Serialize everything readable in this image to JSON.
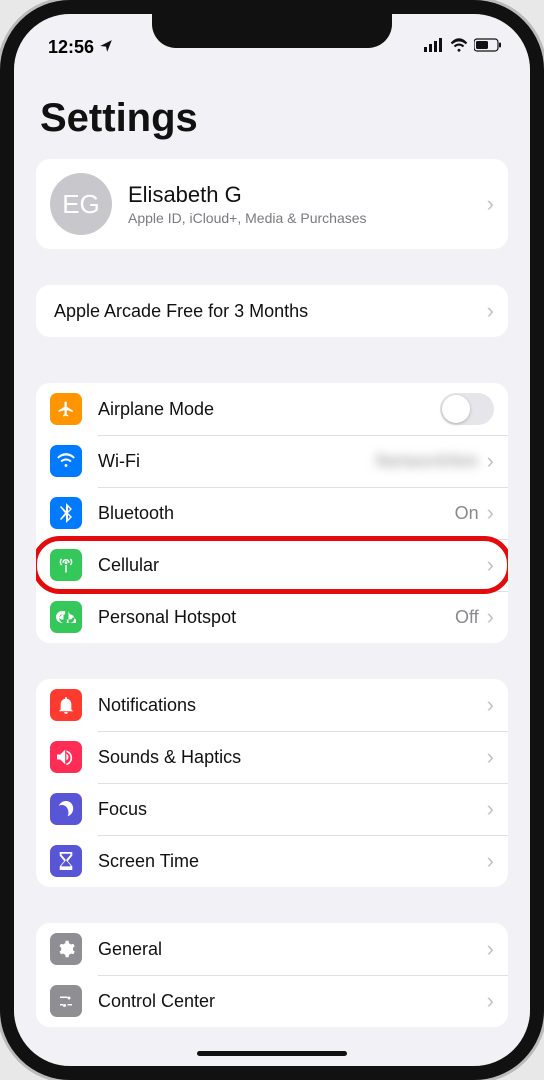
{
  "status": {
    "time": "12:56"
  },
  "title": "Settings",
  "profile": {
    "initials": "EG",
    "name": "Elisabeth G",
    "subtitle": "Apple ID, iCloud+, Media & Purchases"
  },
  "promo": {
    "label": "Apple Arcade Free for 3 Months"
  },
  "connectivity": {
    "airplane": {
      "label": "Airplane Mode"
    },
    "wifi": {
      "label": "Wi-Fi",
      "value": "NetworkNm"
    },
    "bluetooth": {
      "label": "Bluetooth",
      "value": "On"
    },
    "cellular": {
      "label": "Cellular"
    },
    "hotspot": {
      "label": "Personal Hotspot",
      "value": "Off"
    }
  },
  "alerts": {
    "notifications": {
      "label": "Notifications"
    },
    "sounds": {
      "label": "Sounds & Haptics"
    },
    "focus": {
      "label": "Focus"
    },
    "screentime": {
      "label": "Screen Time"
    }
  },
  "system": {
    "general": {
      "label": "General"
    },
    "controlcenter": {
      "label": "Control Center"
    }
  },
  "highlighted_row": "cellular"
}
